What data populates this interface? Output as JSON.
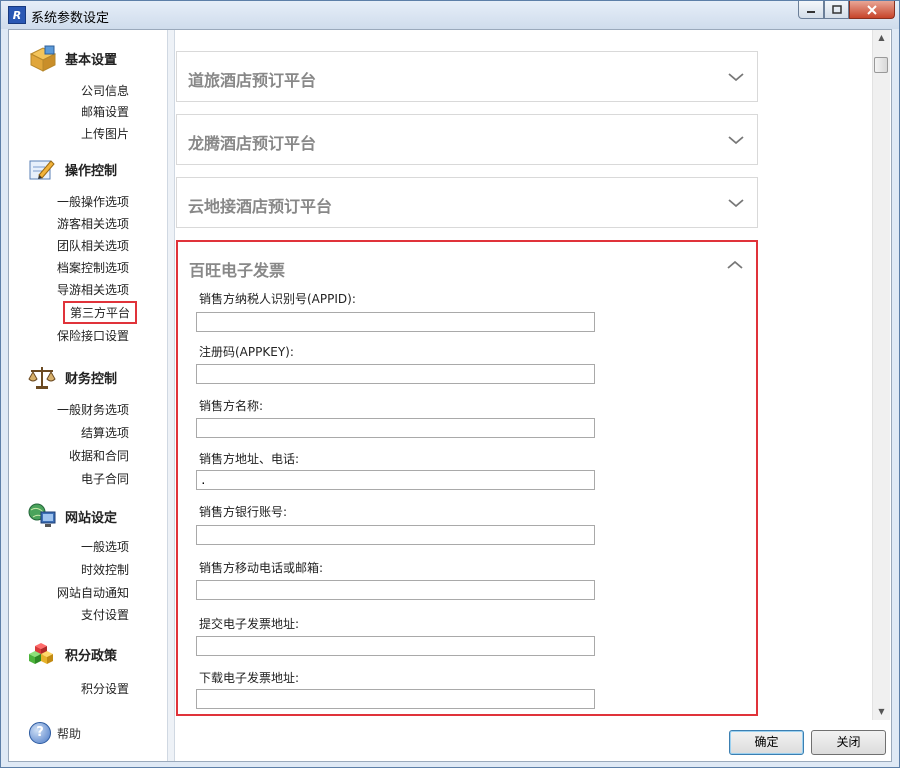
{
  "window": {
    "title": "系统参数设定"
  },
  "sidebar": {
    "groups": [
      {
        "title": "基本设置",
        "icon": "box-icon",
        "items": [
          "公司信息",
          "邮箱设置",
          "上传图片"
        ]
      },
      {
        "title": "操作控制",
        "icon": "pencil-icon",
        "items": [
          "一般操作选项",
          "游客相关选项",
          "团队相关选项",
          "档案控制选项",
          "导游相关选项",
          "第三方平台",
          "保险接口设置"
        ]
      },
      {
        "title": "财务控制",
        "icon": "scale-icon",
        "items": [
          "一般财务选项",
          "结算选项",
          "收据和合同",
          "电子合同"
        ]
      },
      {
        "title": "网站设定",
        "icon": "network-icon",
        "items": [
          "一般选项",
          "时效控制",
          "网站自动通知",
          "支付设置"
        ]
      },
      {
        "title": "积分政策",
        "icon": "cubes-icon",
        "items": [
          "积分设置"
        ]
      }
    ],
    "active_item": "第三方平台",
    "help_label": "帮助"
  },
  "main": {
    "panels": [
      {
        "title": "道旅酒店预订平台",
        "expanded": false
      },
      {
        "title": "龙腾酒店预订平台",
        "expanded": false
      },
      {
        "title": "云地接酒店预订平台",
        "expanded": false
      },
      {
        "title": "百旺电子发票",
        "expanded": true
      }
    ],
    "fields": [
      {
        "label": "销售方纳税人识别号(APPID):",
        "value": ""
      },
      {
        "label": "注册码(APPKEY):",
        "value": ""
      },
      {
        "label": "销售方名称:",
        "value": ""
      },
      {
        "label": "销售方地址、电话:",
        "value": "."
      },
      {
        "label": "销售方银行账号:",
        "value": ""
      },
      {
        "label": "销售方移动电话或邮箱:",
        "value": ""
      },
      {
        "label": "提交电子发票地址:",
        "value": ""
      },
      {
        "label": "下载电子发票地址:",
        "value": ""
      }
    ]
  },
  "footer": {
    "ok_label": "确定",
    "close_label": "关闭"
  },
  "colors": {
    "highlight": "#e0333a",
    "panel_title": "#888888"
  }
}
